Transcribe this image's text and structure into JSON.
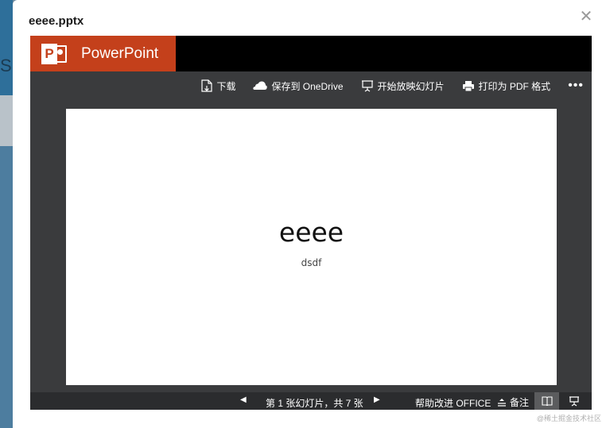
{
  "background": {
    "glyph": "S"
  },
  "dialog": {
    "title": "eeee.pptx",
    "close_icon": "close-icon"
  },
  "viewer": {
    "brand": {
      "logo_letter": "P",
      "name": "PowerPoint",
      "color": "#c4401b"
    },
    "toolbar": {
      "download_label": "下载",
      "save_onedrive_label": "保存到 OneDrive",
      "start_slideshow_label": "开始放映幻灯片",
      "print_pdf_label": "打印为 PDF 格式",
      "more_label": "•••"
    },
    "slide": {
      "title": "eeee",
      "subtitle": "dsdf"
    },
    "statusbar": {
      "prev_icon": "◀",
      "slide_counter": "第 1 张幻灯片，共 7 张",
      "next_icon": "▶",
      "help_label": "帮助改进 OFFICE",
      "notes_label": "备注"
    }
  },
  "watermark": "@稀土掘金技术社区"
}
